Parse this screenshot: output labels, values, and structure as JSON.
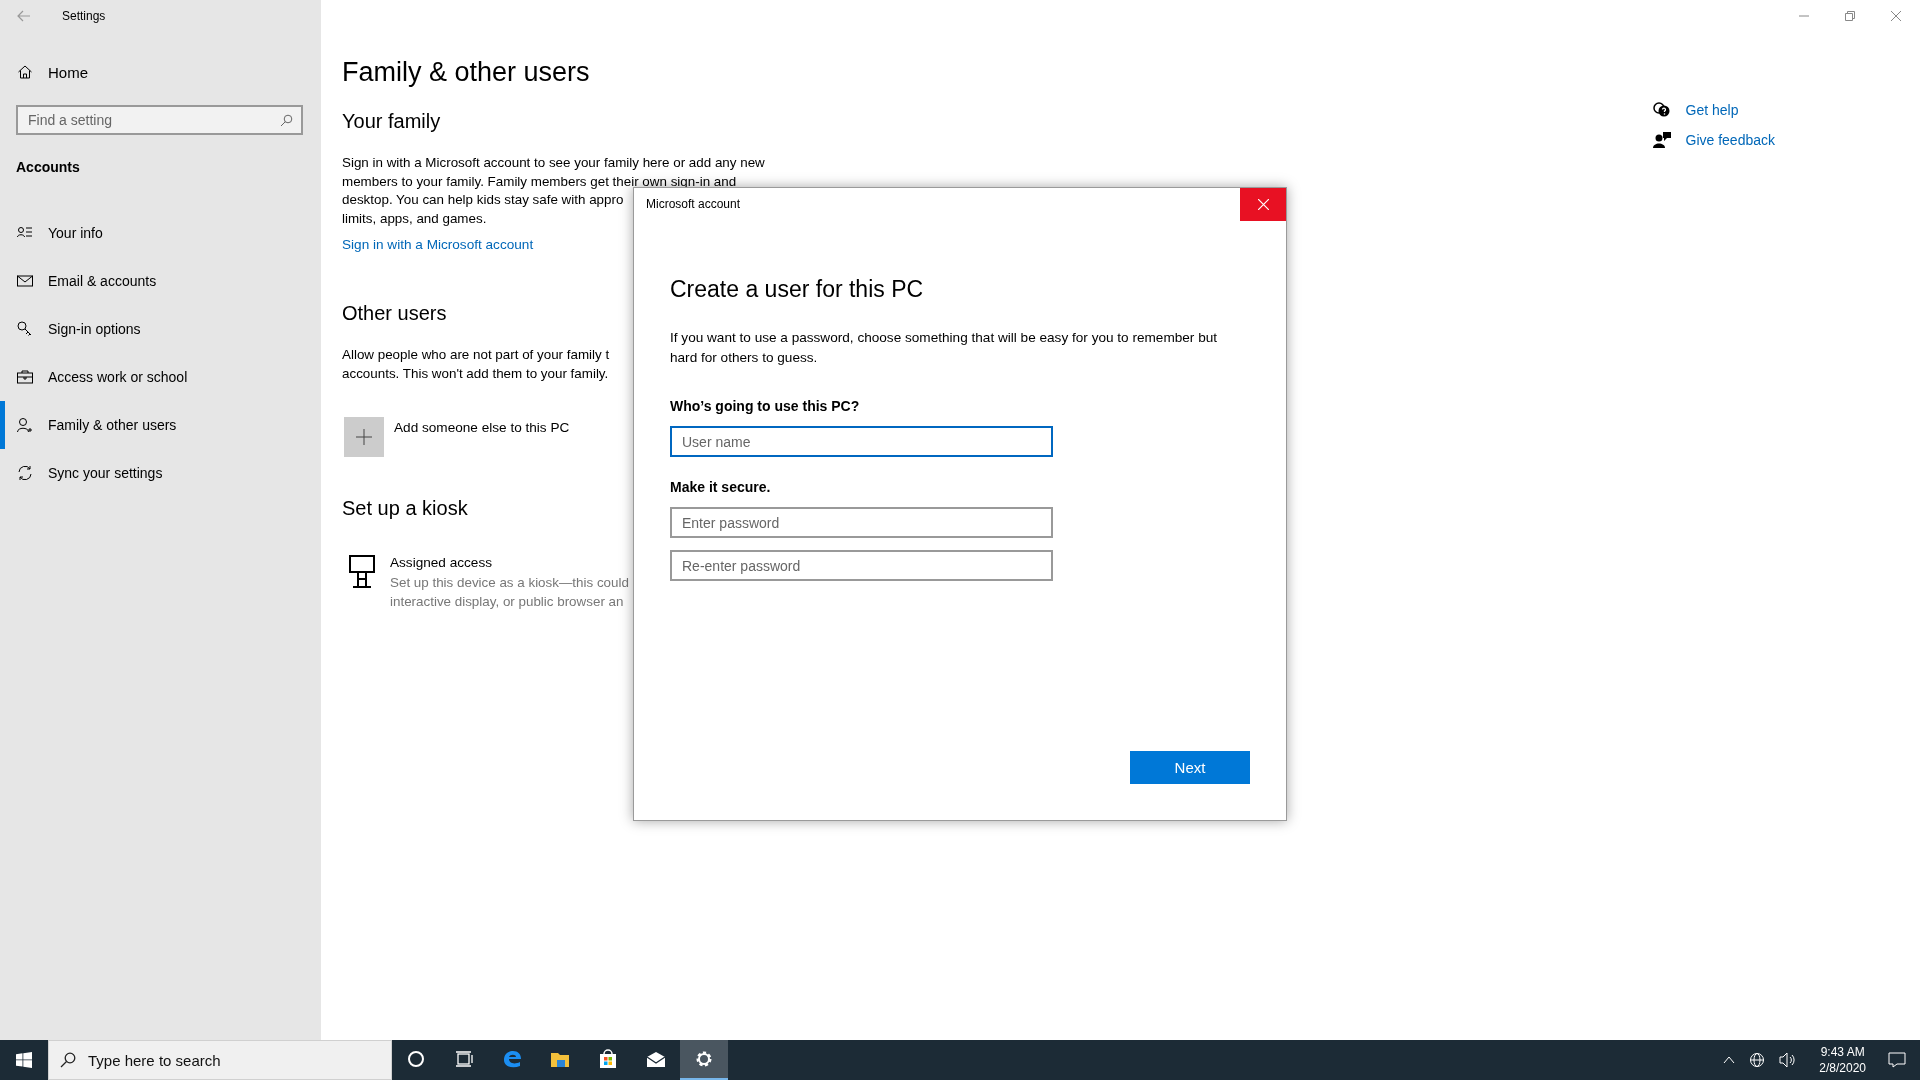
{
  "window": {
    "title": "Settings"
  },
  "sidebar": {
    "home": "Home",
    "search": {
      "placeholder": "Find a setting"
    },
    "section": "Accounts",
    "items": [
      {
        "label": "Your info",
        "selected": false
      },
      {
        "label": "Email & accounts",
        "selected": false
      },
      {
        "label": "Sign-in options",
        "selected": false
      },
      {
        "label": "Access work or school",
        "selected": false
      },
      {
        "label": "Family & other users",
        "selected": true
      },
      {
        "label": "Sync your settings",
        "selected": false
      }
    ]
  },
  "page": {
    "title": "Family & other users",
    "your_family": {
      "heading": "Your family",
      "lines": [
        "Sign in with a Microsoft account to see your family here or add any new",
        "members to your family. Family members get their own sign-in and",
        "desktop. You can help kids stay safe with appro",
        "limits, apps, and games."
      ],
      "link": "Sign in with a Microsoft account"
    },
    "other_users": {
      "heading": "Other users",
      "lines": [
        "Allow people who are not part of your family t",
        "accounts. This won't add them to your family."
      ],
      "add": "Add someone else to this PC"
    },
    "kiosk": {
      "heading": "Set up a kiosk",
      "title": "Assigned access",
      "lines": [
        "Set up this device as a kiosk—this could",
        "interactive display, or public browser an"
      ]
    }
  },
  "help_links": [
    "Get help",
    "Give feedback"
  ],
  "dialog": {
    "title": "Microsoft account",
    "heading": "Create a user for this PC",
    "text": "If you want to use a password, choose something that will be easy for you to remember but hard for others to guess.",
    "question": "Who’s going to use this PC?",
    "secure": "Make it secure.",
    "fields": [
      {
        "placeholder": "User name",
        "focused": true
      },
      {
        "placeholder": "Enter password",
        "focused": false
      },
      {
        "placeholder": "Re-enter password",
        "focused": false
      }
    ],
    "next": "Next"
  },
  "taskbar": {
    "search": {
      "placeholder": "Type here to search"
    },
    "apps": [
      {
        "selected": false
      },
      {
        "selected": false
      },
      {
        "selected": false
      },
      {
        "selected": false
      },
      {
        "selected": false
      },
      {
        "selected": false
      },
      {
        "selected": true
      }
    ],
    "time": "9:43 AM",
    "date": "2/8/2020"
  }
}
